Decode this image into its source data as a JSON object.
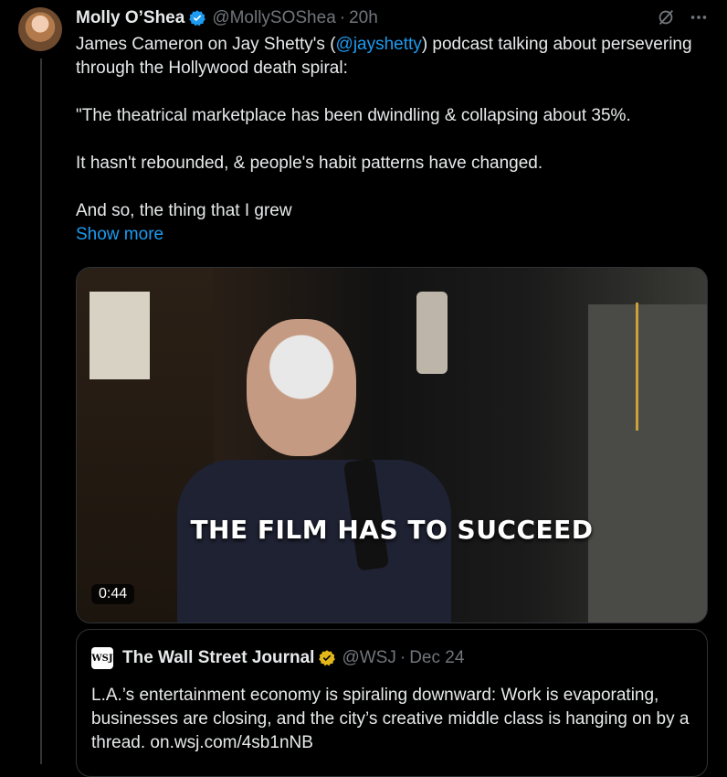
{
  "tweet": {
    "author": {
      "display_name": "Molly O’Shea",
      "handle": "@MollySOShea",
      "verified": true
    },
    "timestamp": "20h",
    "text": {
      "line1_before": "James Cameron on Jay Shetty's (",
      "mention": "@jayshetty",
      "line1_after": ") podcast talking about persevering through the Hollywood death spiral:",
      "quote_line": "\"The theatrical marketplace has been dwindling & collapsing about 35%.",
      "line3": "It hasn't rebounded, & people's habit patterns have changed.",
      "line4": "And so, the thing that I grew"
    },
    "show_more_label": "Show more",
    "media": {
      "caption": "THE FILM HAS TO SUCCEED",
      "duration": "0:44"
    }
  },
  "quoted_tweet": {
    "author": {
      "display_name": "The Wall Street Journal",
      "handle": "@WSJ",
      "verified": true
    },
    "logo_text": "WSJ",
    "timestamp": "Dec 24",
    "text": "L.A.’s entertainment economy is spiraling downward: Work is evaporating, businesses are closing, and the city’s creative middle class is hanging on by a thread. on.wsj.com/4sb1nNB"
  },
  "colors": {
    "background": "#000000",
    "text": "#e7e9ea",
    "muted": "#71767b",
    "accent": "#1d9bf0",
    "gold_badge": "#e2b719"
  },
  "icons": [
    "verified-badge-icon",
    "grok-icon",
    "more-icon",
    "gold-verified-badge-icon"
  ]
}
